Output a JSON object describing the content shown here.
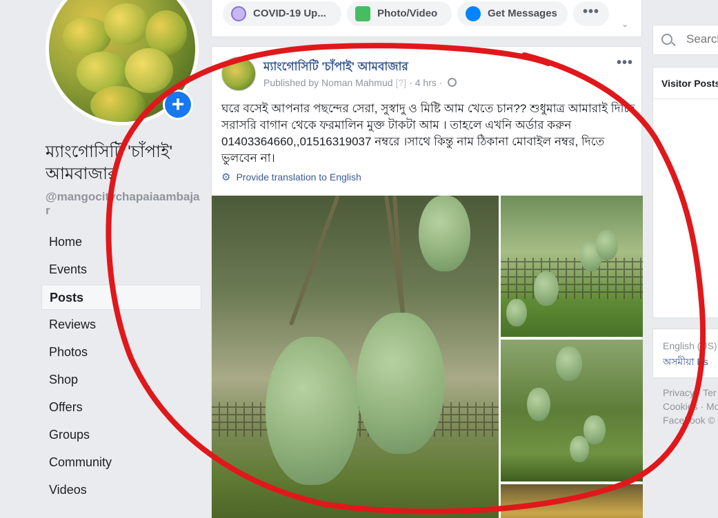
{
  "sidebar": {
    "page_name": "ম্যাংগোসিটি 'চাঁপাই' আমবাজার",
    "handle": "@mangocitychapaiaambajar",
    "nav": [
      "Home",
      "Events",
      "Posts",
      "Reviews",
      "Photos",
      "Shop",
      "Offers",
      "Groups",
      "Community",
      "Videos"
    ],
    "active": "Posts"
  },
  "composer": {
    "chips": [
      "COVID-19 Up...",
      "Photo/Video",
      "Get Messages"
    ],
    "more": "•••"
  },
  "post": {
    "page_name": "ম্যাংগোসিটি 'চাঁপাই' আমবাজার",
    "published_by": "Published by Noman Mahmud",
    "help": "[?]",
    "time": "4 hrs",
    "more": "•••",
    "body": "ঘরে বসেই আপনার পছন্দের সেরা, সুস্বাদু ও মিষ্টি আম খেতে চান?? শুধুমাত্র আমারাই দিচ্ছি সরাসরি বাগান থেকে ফরমালিন মুক্ত টাকটা আম । তাহলে এখনি অর্ডার করুন 01403364660,,01516319037 নম্বরে ।সাথে কিন্তু নাম ঠিকানা মোবাইল নম্বর, দিতে ভুলবেন না।",
    "translate": "Provide translation to English"
  },
  "right": {
    "search_placeholder": "Search",
    "visitor_title": "Visitor Posts",
    "lang_current": "English (US)",
    "lang_other": "অসমীয়া  Es",
    "footer": [
      "Privacy · Ter",
      "Cookies · Mo",
      "Facebook ©"
    ]
  },
  "colors": {
    "link": "#385898",
    "accent": "#1877f2",
    "annotation": "#e0181b",
    "background": "#e9ebee"
  }
}
